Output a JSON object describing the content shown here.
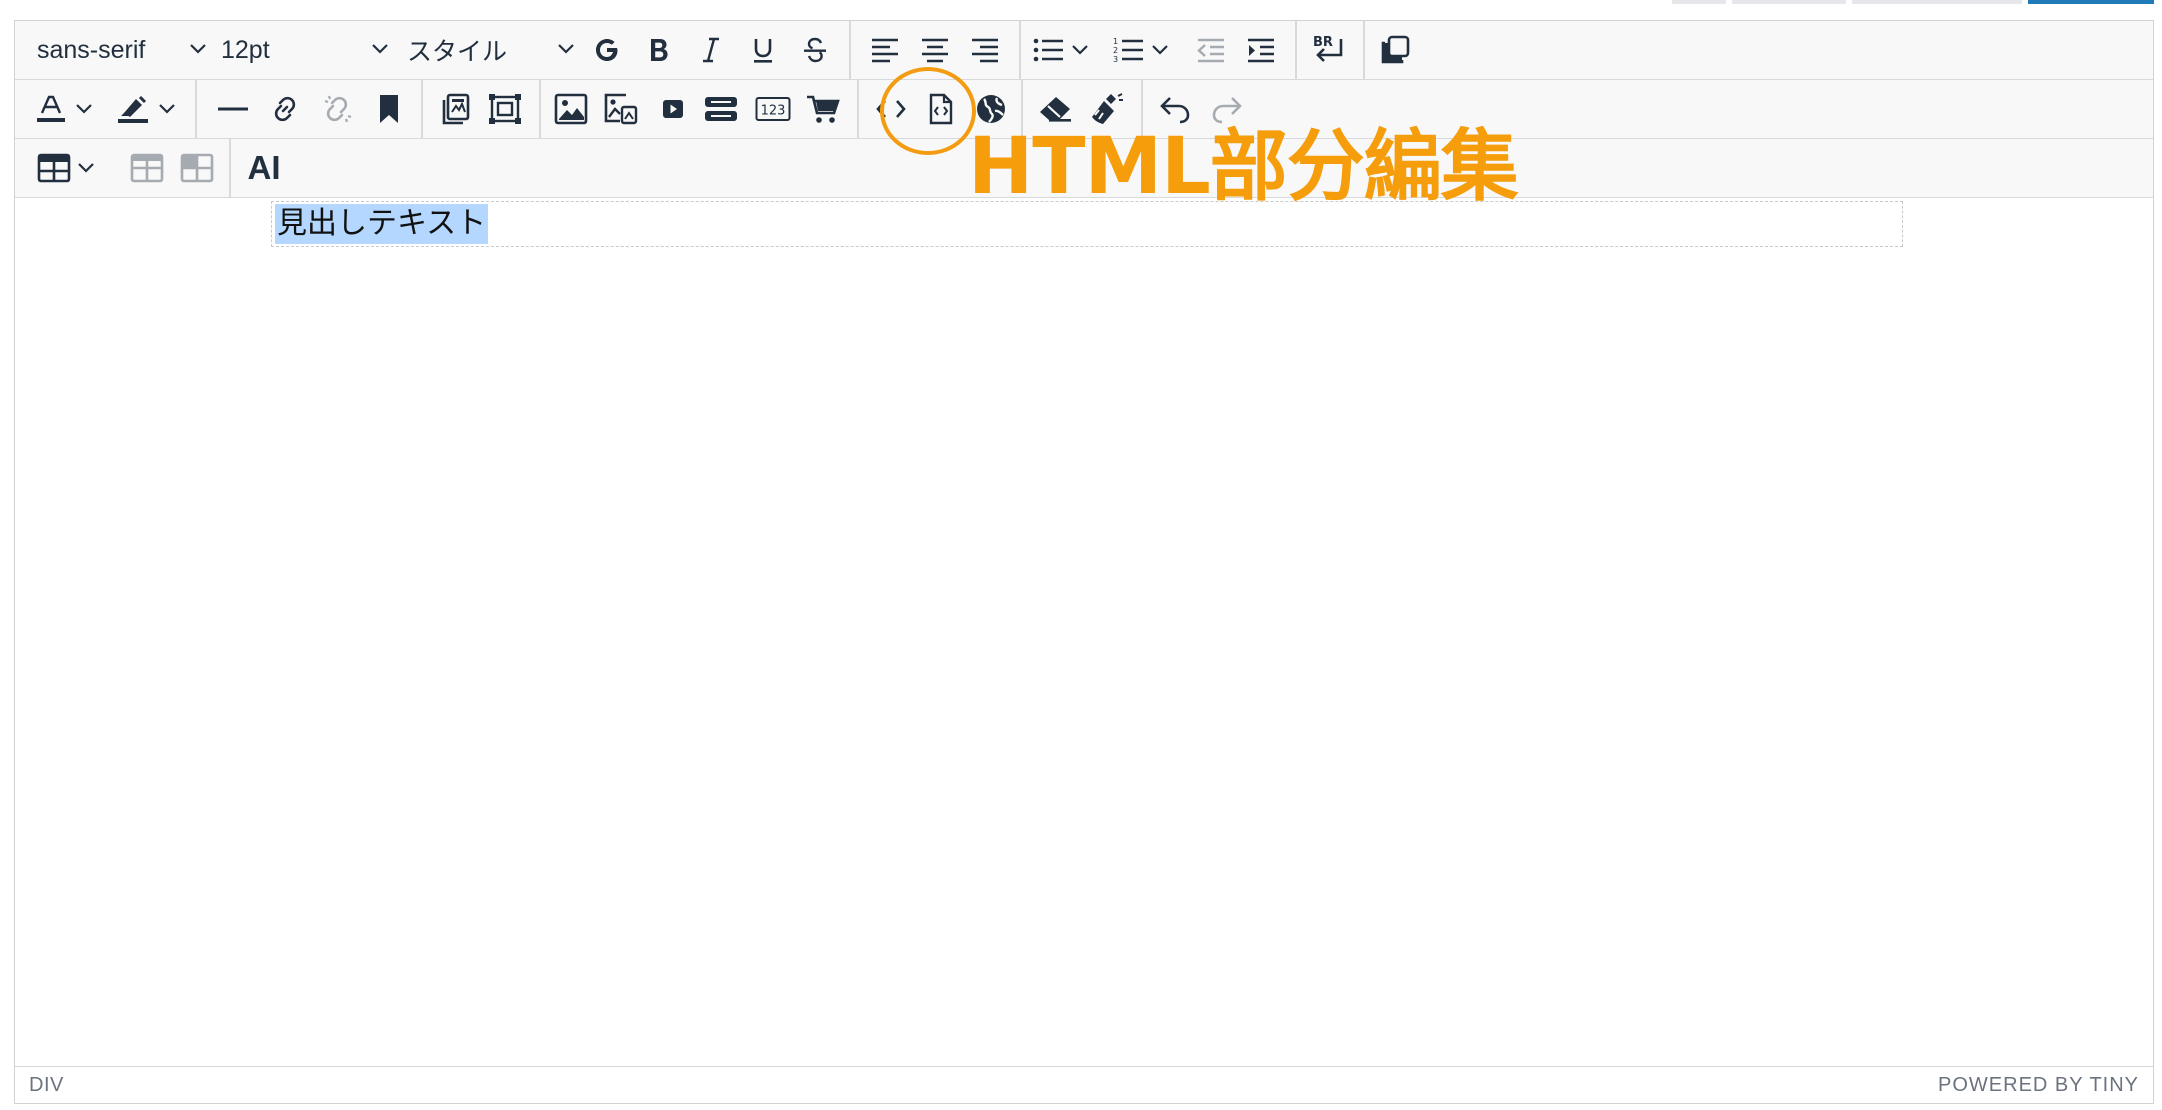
{
  "toolbar": {
    "font_family": "sans-serif",
    "font_size": "12pt",
    "style": "スタイル",
    "ai_label": "AI"
  },
  "content": {
    "heading": "見出しテキスト"
  },
  "statusbar": {
    "path": "DIV",
    "brand": "POWERED BY TINY"
  },
  "annotation": {
    "label": "HTML部分編集",
    "color": "#f59d0b"
  },
  "colors": {
    "icon": "#222f3e",
    "disabled": "#a6abb1",
    "toolbar_bg": "#f8f8f8",
    "border": "#d7d9dc",
    "selection": "#b4d7ff",
    "accent": "#f39c12"
  }
}
